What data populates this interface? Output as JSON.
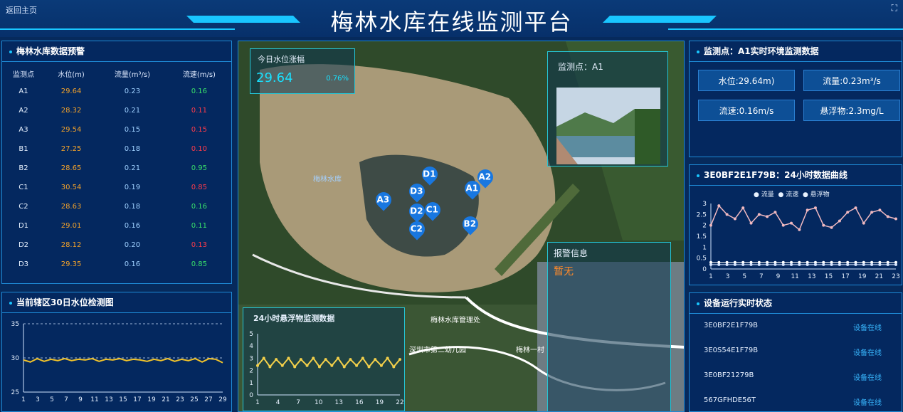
{
  "header": {
    "back_label": "返回主页",
    "title": "梅林水库在线监测平台",
    "fullscreen_icon": "fullscreen-icon"
  },
  "warning_panel": {
    "title": "梅林水库数据预警",
    "columns": [
      "监测点",
      "水位(m)",
      "流量(m³/s)",
      "流速(m/s)"
    ],
    "rows": [
      {
        "point": "A1",
        "level": "29.64",
        "flow": "0.23",
        "speed": "0.16",
        "alert": false
      },
      {
        "point": "A2",
        "level": "28.32",
        "flow": "0.21",
        "speed": "0.11",
        "alert": true
      },
      {
        "point": "A3",
        "level": "29.54",
        "flow": "0.15",
        "speed": "0.15",
        "alert": true
      },
      {
        "point": "B1",
        "level": "27.25",
        "flow": "0.18",
        "speed": "0.10",
        "alert": true
      },
      {
        "point": "B2",
        "level": "28.65",
        "flow": "0.21",
        "speed": "0.95",
        "alert": false
      },
      {
        "point": "C1",
        "level": "30.54",
        "flow": "0.19",
        "speed": "0.85",
        "alert": true
      },
      {
        "point": "C2",
        "level": "28.63",
        "flow": "0.18",
        "speed": "0.16",
        "alert": false
      },
      {
        "point": "D1",
        "level": "29.01",
        "flow": "0.16",
        "speed": "0.11",
        "alert": false
      },
      {
        "point": "D2",
        "level": "28.12",
        "flow": "0.20",
        "speed": "0.13",
        "alert": true
      },
      {
        "point": "D3",
        "level": "29.35",
        "flow": "0.16",
        "speed": "0.85",
        "alert": false
      }
    ]
  },
  "level_chart_panel": {
    "title": "当前辖区30日水位检测图",
    "chart_data": {
      "type": "line",
      "x": [
        1,
        2,
        3,
        4,
        5,
        6,
        7,
        8,
        9,
        10,
        11,
        12,
        13,
        14,
        15,
        16,
        17,
        18,
        19,
        20,
        21,
        22,
        23,
        24,
        25,
        26,
        27,
        28,
        29,
        30
      ],
      "xticks": [
        "1",
        "3",
        "5",
        "7",
        "9",
        "11",
        "13",
        "15",
        "17",
        "19",
        "21",
        "23",
        "25",
        "27",
        "29"
      ],
      "yticks": [
        "25",
        "30",
        "35"
      ],
      "ylim": [
        25,
        35
      ],
      "values": [
        29.7,
        29.4,
        29.9,
        29.5,
        29.8,
        29.6,
        29.9,
        29.6,
        29.8,
        29.7,
        29.9,
        29.5,
        29.8,
        29.7,
        29.9,
        29.6,
        29.8,
        29.7,
        29.5,
        29.8,
        29.6,
        29.9,
        29.5,
        29.8,
        29.6,
        29.9,
        29.4,
        29.9,
        29.8,
        29.3
      ]
    }
  },
  "map": {
    "rise_title": "今日水位涨幅",
    "rise_value": "29.64",
    "rise_pct": "0.76%",
    "map_labels": [
      "梅林水库",
      "梅林水库管理处",
      "深圳市第二幼儿园",
      "梅林一村"
    ],
    "markers": [
      {
        "id": "A1",
        "x": 318,
        "y": 196
      },
      {
        "id": "A2",
        "x": 336,
        "y": 180
      },
      {
        "id": "A3",
        "x": 193,
        "y": 212
      },
      {
        "id": "B2",
        "x": 315,
        "y": 246
      },
      {
        "id": "C1",
        "x": 262,
        "y": 226
      },
      {
        "id": "C2",
        "x": 240,
        "y": 253
      },
      {
        "id": "D1",
        "x": 258,
        "y": 176
      },
      {
        "id": "D2",
        "x": 240,
        "y": 228
      },
      {
        "id": "D3",
        "x": 240,
        "y": 200
      }
    ],
    "snapshot_title": "监测点：A1",
    "alarm_title": "报警信息",
    "alarm_value": "暂无",
    "suspended_title": "24小时悬浮物监测数据",
    "suspended_chart": {
      "type": "line",
      "xticks": [
        "1",
        "4",
        "7",
        "10",
        "13",
        "16",
        "19",
        "22"
      ],
      "yticks": [
        "0",
        "1",
        "2",
        "3",
        "4",
        "5"
      ],
      "ylim": [
        0,
        5
      ],
      "values": [
        2.4,
        3.0,
        2.3,
        2.9,
        2.4,
        3.0,
        2.3,
        2.9,
        2.4,
        3.0,
        2.3,
        2.9,
        2.4,
        3.0,
        2.3,
        2.9,
        2.4,
        3.0,
        2.3,
        2.9,
        2.4,
        3.0,
        2.3,
        2.9
      ]
    }
  },
  "env_panel": {
    "title": "监测点：A1实时环境监测数据",
    "items": [
      "水位:29.64m)",
      "流量:0.23m³/s",
      "流速:0.16m/s",
      "悬浮物:2.3mg/L"
    ]
  },
  "curve_panel": {
    "title": "3E0BF2E1F79B：24小时数据曲线",
    "legend": [
      "流量",
      "流速",
      "悬浮物"
    ],
    "chart_data": {
      "type": "line",
      "x": [
        1,
        2,
        3,
        4,
        5,
        6,
        7,
        8,
        9,
        10,
        11,
        12,
        13,
        14,
        15,
        16,
        17,
        18,
        19,
        20,
        21,
        22,
        23,
        24
      ],
      "xticks": [
        "1",
        "3",
        "5",
        "7",
        "9",
        "11",
        "13",
        "15",
        "17",
        "19",
        "21",
        "23"
      ],
      "yticks": [
        "0",
        "0.5",
        "1",
        "1.5",
        "2",
        "2.5",
        "3"
      ],
      "ylim": [
        0,
        3
      ],
      "series": [
        {
          "name": "流量",
          "values": [
            2.0,
            2.9,
            2.5,
            2.3,
            2.8,
            2.1,
            2.5,
            2.4,
            2.6,
            2.0,
            2.1,
            1.8,
            2.7,
            2.8,
            2.0,
            1.9,
            2.2,
            2.6,
            2.8,
            2.1,
            2.6,
            2.7,
            2.4,
            2.3
          ]
        },
        {
          "name": "流速",
          "values": [
            0.3,
            0.3,
            0.3,
            0.3,
            0.3,
            0.3,
            0.3,
            0.3,
            0.3,
            0.3,
            0.3,
            0.3,
            0.3,
            0.3,
            0.3,
            0.3,
            0.3,
            0.3,
            0.3,
            0.3,
            0.3,
            0.3,
            0.3,
            0.3
          ]
        },
        {
          "name": "悬浮物",
          "values": [
            0.2,
            0.2,
            0.2,
            0.2,
            0.2,
            0.2,
            0.2,
            0.2,
            0.2,
            0.2,
            0.2,
            0.2,
            0.2,
            0.2,
            0.2,
            0.2,
            0.2,
            0.2,
            0.2,
            0.2,
            0.2,
            0.2,
            0.2,
            0.2
          ]
        }
      ]
    }
  },
  "device_panel": {
    "title": "设备运行实时状态",
    "devices": [
      {
        "id": "3E0BF2E1F79B",
        "status": "设备在线"
      },
      {
        "id": "3E0S54E1F79B",
        "status": "设备在线"
      },
      {
        "id": "3E0BF21279B",
        "status": "设备在线"
      },
      {
        "id": "567GFHDE56T",
        "status": "设备在线"
      }
    ]
  },
  "colors": {
    "accent": "#19c6ff",
    "ok": "#38e06a",
    "bad": "#ff3b4a",
    "level": "#f3a22a"
  }
}
